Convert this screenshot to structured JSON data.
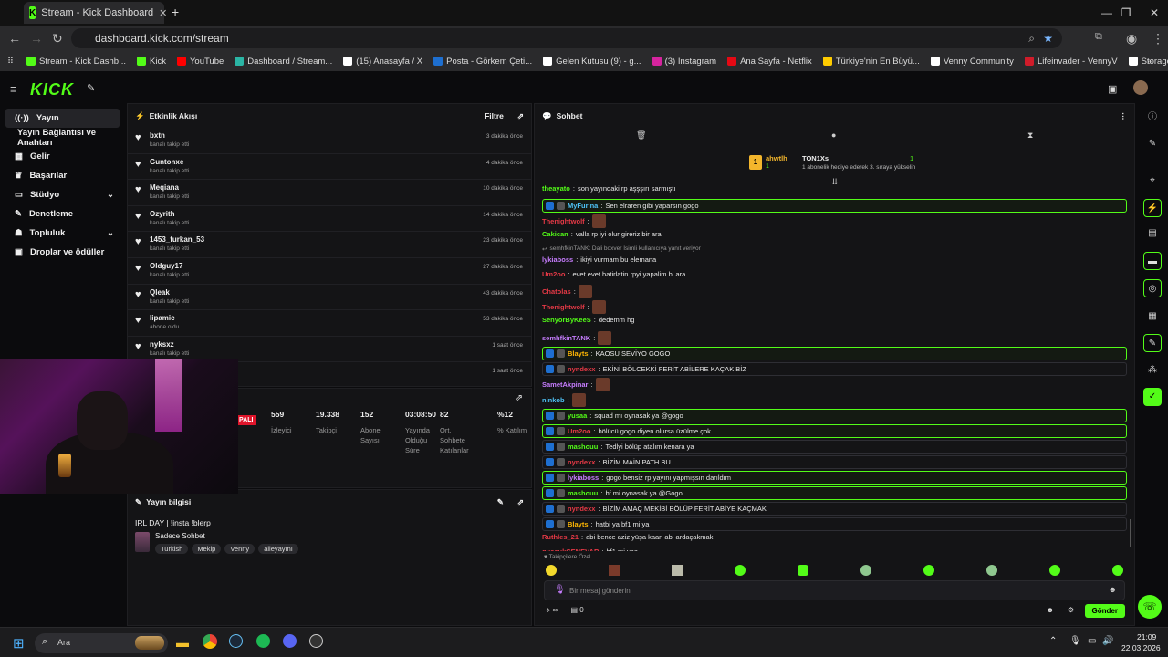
{
  "browser": {
    "tab_title": "Stream - Kick Dashboard",
    "url": "dashboard.kick.com/stream"
  },
  "bookmarks": [
    "Stream - Kick Dashb...",
    "Kick",
    "YouTube",
    "Dashboard / Stream...",
    "(15) Anasayfa / X",
    "Posta - Görkem Çeti...",
    "Gelen Kutusu (9) - g...",
    "(3) Instagram",
    "Ana Sayfa - Netflix",
    "Türkiye'nin En Büyü...",
    "Venny Community",
    "Lifeinvader - VennyV",
    "Storage | Fivemanage"
  ],
  "bookmark_colors": [
    "#53fc18",
    "#53fc18",
    "#ff0000",
    "#2bb5a5",
    "#ffffff",
    "#1e6fd0",
    "#ffffff",
    "#d6249f",
    "#e50914",
    "#ffcc00",
    "#ffffff",
    "#d01c2a",
    "#ffffff"
  ],
  "sidebar": {
    "items": [
      "Yayın",
      "Yayın Bağlantısı ve Anahtarı",
      "Gelir",
      "Başarılar",
      "Stüdyo",
      "Denetleme",
      "Topluluk",
      "Droplar ve ödüller"
    ]
  },
  "activity": {
    "title": "Etkinlik Akışı",
    "filter": "Filtre",
    "events": [
      {
        "name": "bxtn",
        "sub": "kanalı takip etti",
        "time": "3 dakika önce"
      },
      {
        "name": "Guntonxe",
        "sub": "kanalı takip etti",
        "time": "4 dakika önce"
      },
      {
        "name": "Meqiana",
        "sub": "kanalı takip etti",
        "time": "10 dakika önce"
      },
      {
        "name": "Ozyrith",
        "sub": "kanalı takip etti",
        "time": "14 dakika önce"
      },
      {
        "name": "1453_furkan_53",
        "sub": "kanalı takip etti",
        "time": "23 dakika önce"
      },
      {
        "name": "Oldguy17",
        "sub": "kanalı takip etti",
        "time": "27 dakika önce"
      },
      {
        "name": "Qleak",
        "sub": "kanalı takip etti",
        "time": "43 dakika önce"
      },
      {
        "name": "lipamic",
        "sub": "abone oldu",
        "time": "53 dakika önce"
      },
      {
        "name": "nyksxz",
        "sub": "kanalı takip etti",
        "time": "1 saat önce"
      },
      {
        "name": "",
        "sub": "",
        "time": "1 saat önce"
      }
    ]
  },
  "stats": {
    "live": "PALI",
    "partial": "ldu\nin",
    "items": [
      {
        "v": "559",
        "l": "İzleyici"
      },
      {
        "v": "19.338",
        "l": "Takipçi"
      },
      {
        "v": "152",
        "l": "Abone Sayısı"
      },
      {
        "v": "03:08:50",
        "l": "Yayında Olduğu Süre"
      },
      {
        "v": "82",
        "l": "Ort. Sohbete Katılanlar"
      },
      {
        "v": "%12",
        "l": "% Katılım"
      }
    ]
  },
  "stream_info": {
    "title": "Yayın bilgisi",
    "stream_title": "IRL DAY | !insta !blerp",
    "category": "Sadece Sohbet",
    "tags": [
      "Turkish",
      "Mekip",
      "Venny",
      "aileyayını"
    ]
  },
  "chat": {
    "title": "Sohbet",
    "gift_user": "ahwtlh",
    "gift_user_count": "1",
    "gift_target": "TON1Xs",
    "gift_count": "1",
    "gift_text": "1 abonelik hediye ederek 3. sıraya yükselin",
    "messages": [
      {
        "u": "theayato",
        "c": "#53fc18",
        "t": "son yayındaki rp aşşşırı sarmıştı",
        "style": ""
      },
      {
        "u": "MyFurina",
        "c": "#4fc3f7",
        "t": "Sen elraren gibi yaparsın gogo",
        "style": "box"
      },
      {
        "u": "Thenightwolf",
        "c": "#e63946",
        "t": "",
        "style": "",
        "emote": true
      },
      {
        "u": "Cakican",
        "c": "#53fc18",
        "t": "valla rp iyi olur gireriz bir ara",
        "style": ""
      },
      {
        "u": "",
        "c": "#999",
        "t": "semhfkinTANK: Dali boxver İsimli kullanıcıya yanıt veriyor",
        "style": "reply"
      },
      {
        "u": "lykiaboss",
        "c": "#c77dff",
        "t": "ikiyi vurmam bu elemana",
        "style": ""
      },
      {
        "u": "Um2oo",
        "c": "#e63946",
        "t": "evet evet hatirlatin rpyi yapalim bi ara",
        "style": ""
      },
      {
        "u": "Chatolas",
        "c": "#e63946",
        "t": "",
        "style": "",
        "emote": true
      },
      {
        "u": "Thenightwolf",
        "c": "#e63946",
        "t": "",
        "style": "",
        "emote": true
      },
      {
        "u": "SenyorByKeeS",
        "c": "#53fc18",
        "t": "dedemm hg",
        "style": ""
      },
      {
        "u": "semhfkinTANK",
        "c": "#c77dff",
        "t": "",
        "style": "",
        "emote": true
      },
      {
        "u": "Blayts",
        "c": "#ffb703",
        "t": "KAOSU SEVİYO GOGO",
        "style": "box"
      },
      {
        "u": "nyndexx",
        "c": "#e63946",
        "t": "EKİNİ BÖLCEKKİ FERİT ABİLERE KAÇAK BİZ",
        "style": "box2"
      },
      {
        "u": "SametAkpinar",
        "c": "#c77dff",
        "t": "",
        "style": "",
        "emote": true
      },
      {
        "u": "ninkob",
        "c": "#4fc3f7",
        "t": "",
        "style": "",
        "emote": true
      },
      {
        "u": "yusaa",
        "c": "#53fc18",
        "t": "squad mı oynasak ya @gogo",
        "style": "box"
      },
      {
        "u": "Um2oo",
        "c": "#e63946",
        "t": "bölücü gogo diyen olursa üzülme çok",
        "style": "box"
      },
      {
        "u": "mashouu",
        "c": "#53fc18",
        "t": "Tedlyi bölüp atalım kenara ya",
        "style": "box2"
      },
      {
        "u": "nyndexx",
        "c": "#e63946",
        "t": "BİZİM MAİN PATH BU",
        "style": "box2"
      },
      {
        "u": "lykiaboss",
        "c": "#c77dff",
        "t": "gogo bensiz rp yayını yapmışsın darıldım",
        "style": "box"
      },
      {
        "u": "mashouu",
        "c": "#53fc18",
        "t": "bf mi oynasak ya @Gogo",
        "style": "box"
      },
      {
        "u": "nyndexx",
        "c": "#e63946",
        "t": "BİZİM AMAÇ MEKİBİ BÖLÜP FERİT ABİYE KAÇMAK",
        "style": "box2"
      },
      {
        "u": "Blayts",
        "c": "#ffb703",
        "t": "hatbi ya bf1 mi ya",
        "style": "box2"
      },
      {
        "u": "Ruthles_21",
        "c": "#e63946",
        "t": "abi bence aziz yüşa kaan abi ardaçakmak",
        "style": ""
      },
      {
        "u": "guccukCENEVAR",
        "c": "#e63946",
        "t": "bf1 mi yaa",
        "style": ""
      }
    ],
    "follow_label": "Takipçilere Özel",
    "input_placeholder": "Bir mesaj gönderin",
    "send": "Gönder",
    "count_a": "∞",
    "count_b": "0"
  },
  "taskbar": {
    "search": "Ara",
    "time": "21:09",
    "date": "22.03.2026"
  },
  "colors": {
    "kick_green": "#53fc18",
    "bg": "#0b0b0d",
    "panel": "#141416"
  }
}
